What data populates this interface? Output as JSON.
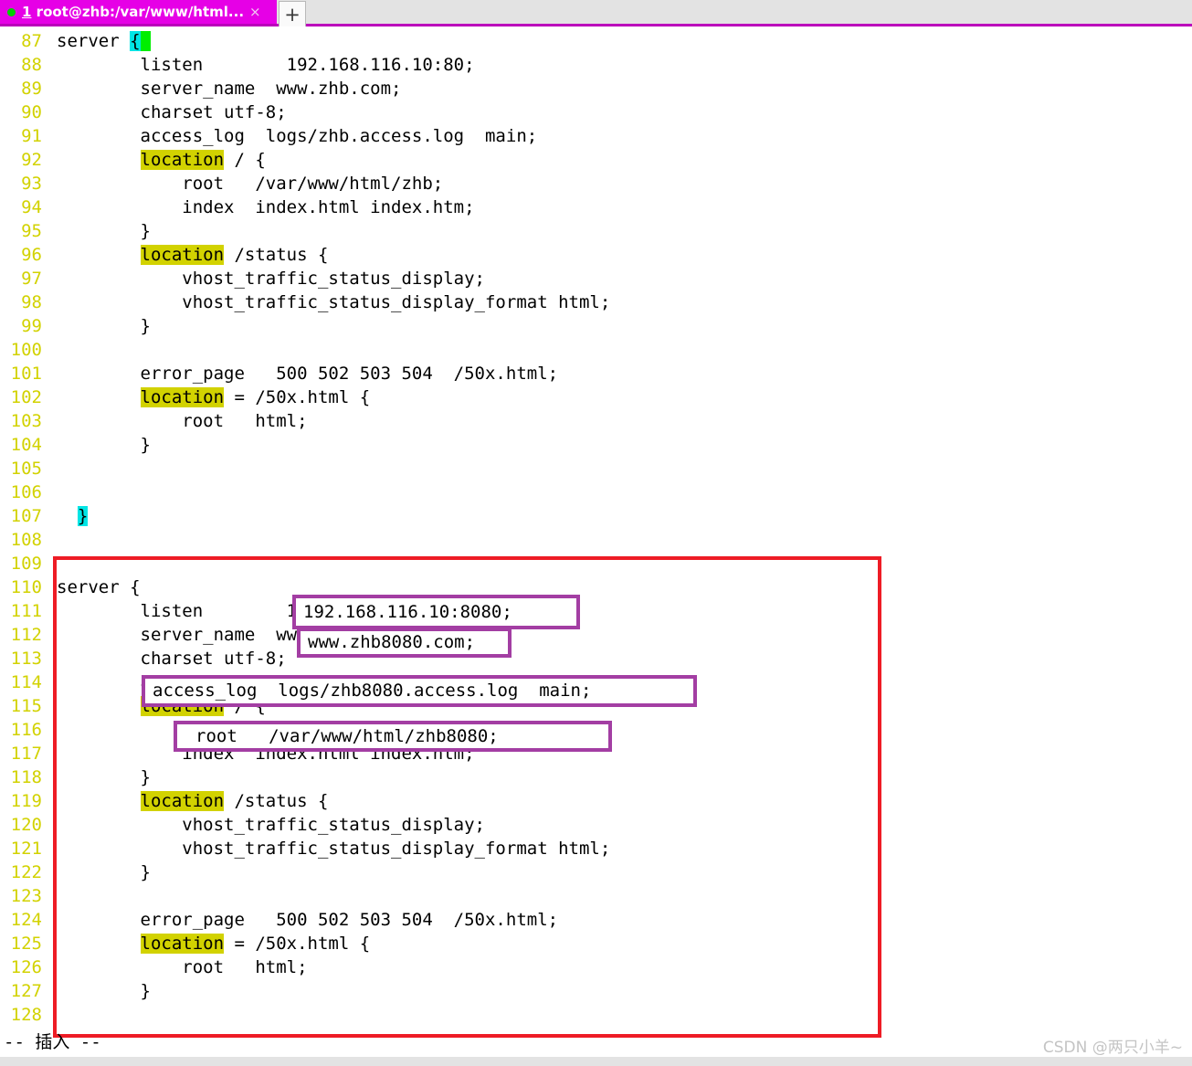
{
  "window": {
    "tab": {
      "index": "1",
      "title": "root@zhb:/var/www/html...",
      "close_label": "×",
      "status_dot": "green",
      "dot_color": "#00d000",
      "bar_color": "#e600e6"
    },
    "new_tab_label": "+"
  },
  "editor": {
    "first_line_number": 87,
    "lines": [
      {
        "num": "87",
        "segments": [
          {
            "t": "server ",
            "s": "plain"
          },
          {
            "t": "{",
            "s": "brace"
          },
          {
            "t": " ",
            "s": "cursor"
          }
        ]
      },
      {
        "num": "88",
        "segments": [
          {
            "t": "        listen        192.168.116.10:80;",
            "s": "plain"
          }
        ]
      },
      {
        "num": "89",
        "segments": [
          {
            "t": "        server_name  www.zhb.com;",
            "s": "plain"
          }
        ]
      },
      {
        "num": "90",
        "segments": [
          {
            "t": "        charset utf-8;",
            "s": "plain"
          }
        ]
      },
      {
        "num": "91",
        "segments": [
          {
            "t": "        access_log  logs/zhb.access.log  main;",
            "s": "plain"
          }
        ]
      },
      {
        "num": "92",
        "segments": [
          {
            "t": "        ",
            "s": "plain"
          },
          {
            "t": "location",
            "s": "loc"
          },
          {
            "t": " / {",
            "s": "plain"
          }
        ]
      },
      {
        "num": "93",
        "segments": [
          {
            "t": "            root   /var/www/html/zhb;",
            "s": "plain"
          }
        ]
      },
      {
        "num": "94",
        "segments": [
          {
            "t": "            index  index.html index.htm;",
            "s": "plain"
          }
        ]
      },
      {
        "num": "95",
        "segments": [
          {
            "t": "        }",
            "s": "plain"
          }
        ]
      },
      {
        "num": "96",
        "segments": [
          {
            "t": "        ",
            "s": "plain"
          },
          {
            "t": "location",
            "s": "loc"
          },
          {
            "t": " /status {",
            "s": "plain"
          }
        ]
      },
      {
        "num": "97",
        "segments": [
          {
            "t": "            vhost_traffic_status_display;",
            "s": "plain"
          }
        ]
      },
      {
        "num": "98",
        "segments": [
          {
            "t": "            vhost_traffic_status_display_format html;",
            "s": "plain"
          }
        ]
      },
      {
        "num": "99",
        "segments": [
          {
            "t": "        }",
            "s": "plain"
          }
        ]
      },
      {
        "num": "100",
        "segments": [
          {
            "t": "",
            "s": "plain"
          }
        ]
      },
      {
        "num": "101",
        "segments": [
          {
            "t": "        error_page   500 502 503 504  /50x.html;",
            "s": "plain"
          }
        ]
      },
      {
        "num": "102",
        "segments": [
          {
            "t": "        ",
            "s": "plain"
          },
          {
            "t": "location",
            "s": "loc"
          },
          {
            "t": " = /50x.html {",
            "s": "plain"
          }
        ]
      },
      {
        "num": "103",
        "segments": [
          {
            "t": "            root   html;",
            "s": "plain"
          }
        ]
      },
      {
        "num": "104",
        "segments": [
          {
            "t": "        }",
            "s": "plain"
          }
        ]
      },
      {
        "num": "105",
        "segments": [
          {
            "t": "",
            "s": "plain"
          }
        ]
      },
      {
        "num": "106",
        "segments": [
          {
            "t": "",
            "s": "plain"
          }
        ]
      },
      {
        "num": "107",
        "segments": [
          {
            "t": "  ",
            "s": "plain"
          },
          {
            "t": "}",
            "s": "brace"
          }
        ]
      },
      {
        "num": "108",
        "segments": [
          {
            "t": "",
            "s": "plain"
          }
        ]
      },
      {
        "num": "109",
        "segments": [
          {
            "t": "",
            "s": "plain"
          }
        ]
      },
      {
        "num": "110",
        "segments": [
          {
            "t": "server {",
            "s": "plain"
          }
        ]
      },
      {
        "num": "111",
        "segments": [
          {
            "t": "        listen        192.168.116.10:8080;",
            "s": "plain"
          }
        ]
      },
      {
        "num": "112",
        "segments": [
          {
            "t": "        server_name  www.zhb8080.com;",
            "s": "plain"
          }
        ]
      },
      {
        "num": "113",
        "segments": [
          {
            "t": "        charset utf-8;",
            "s": "plain"
          }
        ]
      },
      {
        "num": "114",
        "segments": [
          {
            "t": "        access_log  logs/zhb8080.access.log  main;",
            "s": "plain"
          }
        ]
      },
      {
        "num": "115",
        "segments": [
          {
            "t": "        ",
            "s": "plain"
          },
          {
            "t": "location",
            "s": "loc"
          },
          {
            "t": " / {",
            "s": "plain"
          }
        ]
      },
      {
        "num": "116",
        "segments": [
          {
            "t": "            root   /var/www/html/zhb8080;",
            "s": "plain"
          }
        ]
      },
      {
        "num": "117",
        "segments": [
          {
            "t": "            index  index.html index.htm;",
            "s": "plain"
          }
        ]
      },
      {
        "num": "118",
        "segments": [
          {
            "t": "        }",
            "s": "plain"
          }
        ]
      },
      {
        "num": "119",
        "segments": [
          {
            "t": "        ",
            "s": "plain"
          },
          {
            "t": "location",
            "s": "loc"
          },
          {
            "t": " /status {",
            "s": "plain"
          }
        ]
      },
      {
        "num": "120",
        "segments": [
          {
            "t": "            vhost_traffic_status_display;",
            "s": "plain"
          }
        ]
      },
      {
        "num": "121",
        "segments": [
          {
            "t": "            vhost_traffic_status_display_format html;",
            "s": "plain"
          }
        ]
      },
      {
        "num": "122",
        "segments": [
          {
            "t": "        }",
            "s": "plain"
          }
        ]
      },
      {
        "num": "123",
        "segments": [
          {
            "t": "",
            "s": "plain"
          }
        ]
      },
      {
        "num": "124",
        "segments": [
          {
            "t": "        error_page   500 502 503 504  /50x.html;",
            "s": "plain"
          }
        ]
      },
      {
        "num": "125",
        "segments": [
          {
            "t": "        ",
            "s": "plain"
          },
          {
            "t": "location",
            "s": "loc"
          },
          {
            "t": " = /50x.html {",
            "s": "plain"
          }
        ]
      },
      {
        "num": "126",
        "segments": [
          {
            "t": "            root   html;",
            "s": "plain"
          }
        ]
      },
      {
        "num": "127",
        "segments": [
          {
            "t": "        }",
            "s": "plain"
          }
        ]
      },
      {
        "num": "128",
        "segments": [
          {
            "t": "",
            "s": "plain"
          }
        ]
      }
    ]
  },
  "status": {
    "mode": "-- 插入 --"
  },
  "annotations": {
    "red_box": {
      "color": "#ee1c25"
    },
    "purple_color": "#a33ea3",
    "boxes": [
      {
        "label": "listen-value",
        "text": "192.168.116.10:8080;"
      },
      {
        "label": "server-name-value",
        "text": "www.zhb8080.com;"
      },
      {
        "label": "access-log-line",
        "text": "access_log  logs/zhb8080.access.log  main;"
      },
      {
        "label": "root-line",
        "text": "root   /var/www/html/zhb8080;"
      }
    ]
  },
  "watermark": {
    "text": "CSDN @两只小羊~"
  }
}
